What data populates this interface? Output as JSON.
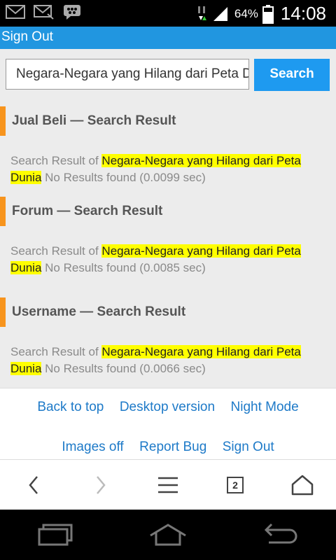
{
  "status_bar": {
    "battery_percent": "64%",
    "time": "14:08",
    "icons": [
      "mail-icon",
      "mail-outline-icon",
      "chat-icon",
      "data-transfer-icon",
      "signal-icon",
      "battery-icon"
    ]
  },
  "top_bar": {
    "sign_out": "Sign Out"
  },
  "search": {
    "value": "Negara-Negara yang Hilang dari Peta Dunia",
    "button_label": "Search"
  },
  "results": [
    {
      "title": "Jual Beli — Search Result",
      "prefix": "Search Result of",
      "query": "Negara-Negara yang Hilang dari Peta Dunia",
      "status": "No Results found (0.0099 sec)"
    },
    {
      "title": "Forum — Search Result",
      "prefix": "Search Result of",
      "query": "Negara-Negara yang Hilang dari Peta Dunia",
      "status": "No Results found (0.0085 sec)"
    },
    {
      "title": "Username — Search Result",
      "prefix": "Search Result of",
      "query": "Negara-Negara yang Hilang dari Peta Dunia",
      "status": "No Results found (0.0066 sec)"
    }
  ],
  "footer_links": {
    "back_to_top": "Back to top",
    "desktop_version": "Desktop version",
    "night_mode": "Night Mode",
    "images_off": "Images off",
    "report_bug": "Report Bug",
    "sign_out": "Sign Out"
  },
  "browser_bar": {
    "tab_count": "2"
  },
  "colors": {
    "accent_blue": "#2196e0",
    "button_blue": "#1e9af0",
    "section_accent": "#f7941d",
    "highlight": "#ffff00",
    "link": "#1e7ac8"
  }
}
